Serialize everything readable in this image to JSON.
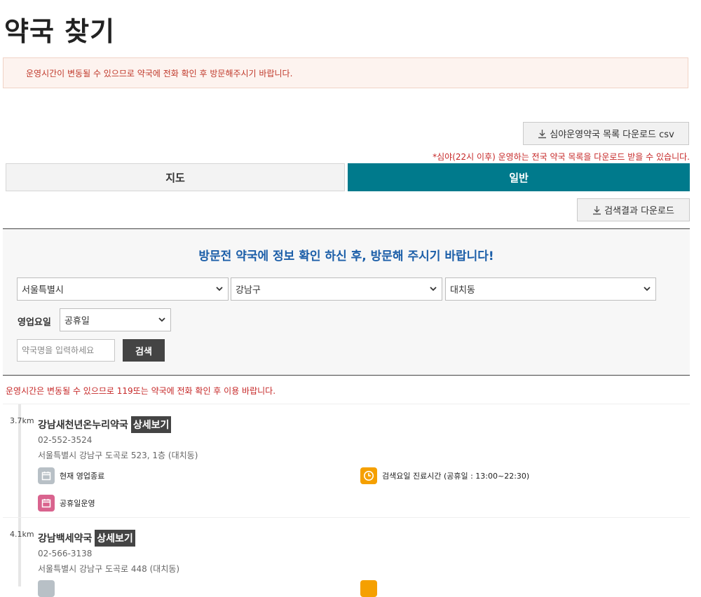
{
  "page": {
    "title": "약국 찾기"
  },
  "notice": {
    "text": "운영시간이 변동될 수 있으므로 약국에 전화 확인 후 방문해주시기 바랍니다."
  },
  "downloads": {
    "csv_label": "심야운영약국 목록 다운로드 csv",
    "csv_note": "*심야(22시 이후) 운영하는 전국 약국 목록을 다운로드 받을 수 있습니다.",
    "result_label": "검색결과 다운로드",
    "icon": "download-icon"
  },
  "tabs": [
    {
      "label": "지도",
      "active": false
    },
    {
      "label": "일반",
      "active": true
    }
  ],
  "search": {
    "heading": "방문전 약국에 정보 확인 하신 후, 방문해 주시기 바랍니다!",
    "city": "서울특별시",
    "district": "강남구",
    "dong": "대치동",
    "day_label": "영업요일",
    "day": "공휴일",
    "name_placeholder": "약국명을 입력하세요",
    "search_button": "검색"
  },
  "results": {
    "note": "운영시간은 변동될 수 있으므로 119또는 약국에 전화 확인 후 이용 바랍니다.",
    "detail_label": "상세보기",
    "items": [
      {
        "distance": "3.7km",
        "name": "강남새천년온누리약국",
        "phone": "02-552-3524",
        "address": "서울특별시 강남구 도곡로 523, 1층 (대치동)",
        "status_now": "현재 영업종료",
        "hours": "검색요일 진료시간 (공휴일 : 13:00~22:30)",
        "holiday": "공휴일운영"
      },
      {
        "distance": "4.1km",
        "name": "강남백세약국",
        "phone": "02-566-3138",
        "address": "서울특별시 강남구 도곡로 448 (대치동)"
      }
    ]
  },
  "colors": {
    "accent": "#007a8c",
    "heading_blue": "#1b5ea8",
    "notice_red": "#c62828",
    "closed_gray": "#b8c0c6",
    "hours_orange": "#f5a000",
    "holiday_pink": "#d9638e"
  }
}
